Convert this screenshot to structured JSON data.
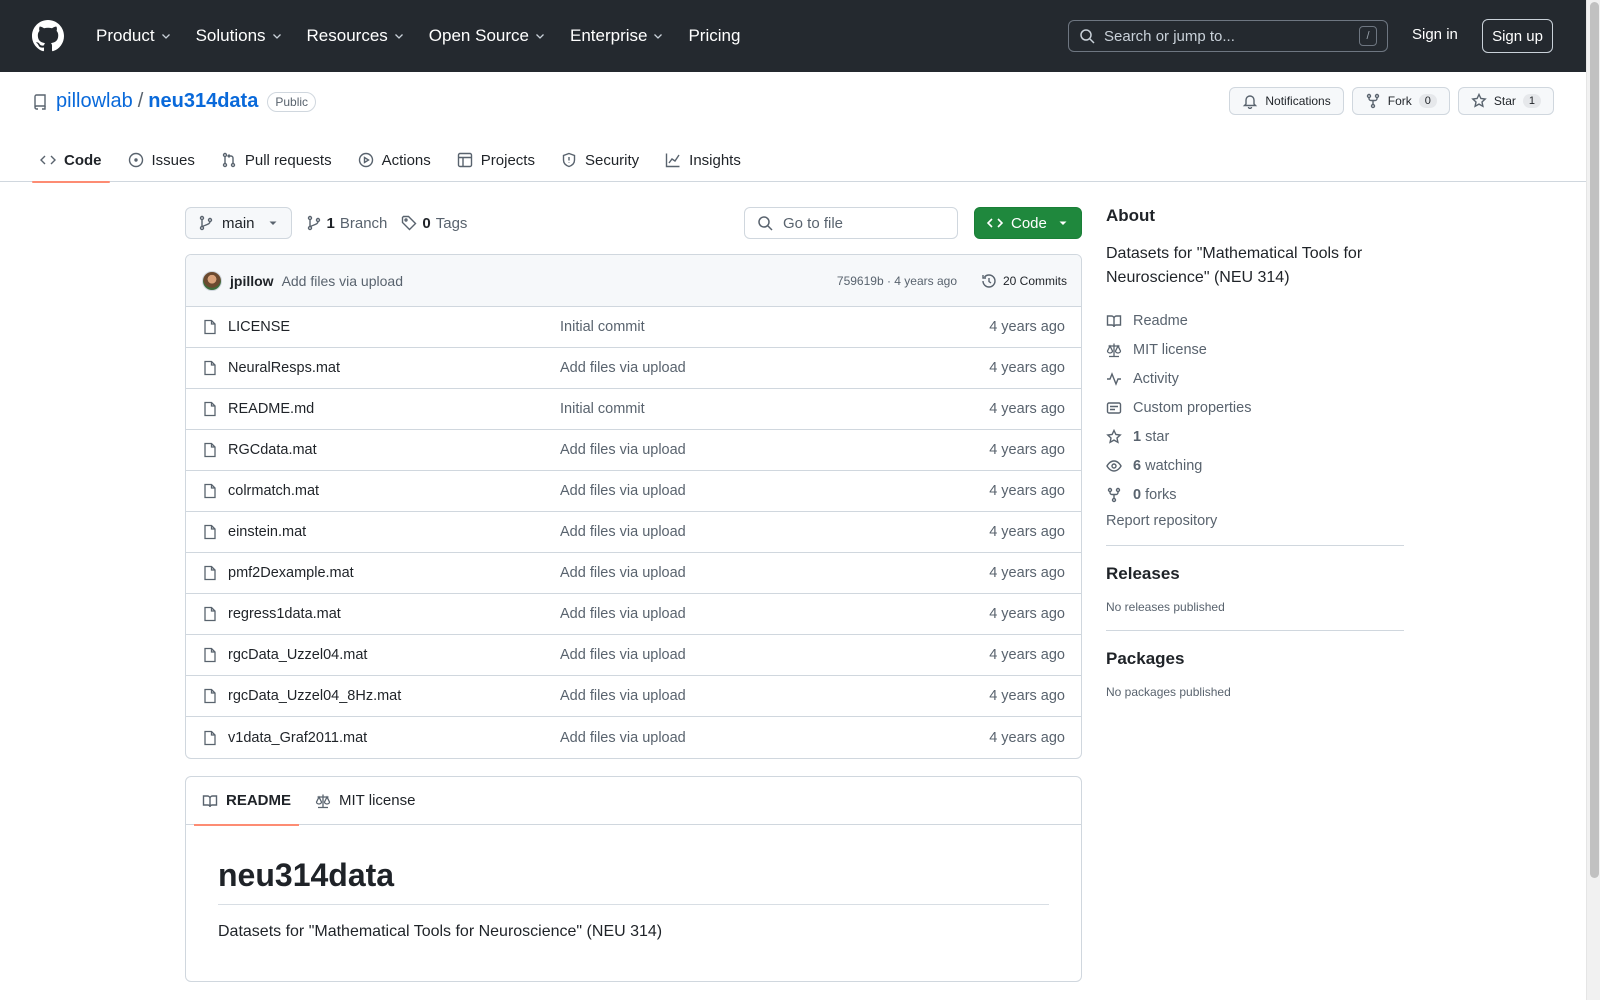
{
  "header": {
    "nav": [
      "Product",
      "Solutions",
      "Resources",
      "Open Source",
      "Enterprise",
      "Pricing"
    ],
    "nav_dropdown": [
      true,
      true,
      true,
      true,
      true,
      false
    ],
    "search_placeholder": "Search or jump to...",
    "search_shortcut": "/",
    "signin": "Sign in",
    "signup": "Sign up"
  },
  "repo": {
    "owner": "pillowlab",
    "separator": "/",
    "name": "neu314data",
    "visibility": "Public",
    "notifications": "Notifications",
    "fork_label": "Fork",
    "fork_count": "0",
    "star_label": "Star",
    "star_count": "1",
    "tabs": [
      {
        "label": "Code",
        "icon": "code-icon",
        "active": true
      },
      {
        "label": "Issues",
        "icon": "issue-icon",
        "active": false
      },
      {
        "label": "Pull requests",
        "icon": "pull-request-icon",
        "active": false
      },
      {
        "label": "Actions",
        "icon": "play-icon",
        "active": false
      },
      {
        "label": "Projects",
        "icon": "table-icon",
        "active": false
      },
      {
        "label": "Security",
        "icon": "shield-icon",
        "active": false
      },
      {
        "label": "Insights",
        "icon": "graph-icon",
        "active": false
      }
    ]
  },
  "toolbar": {
    "branch": "main",
    "branch_count": "1",
    "branch_label": "Branch",
    "tag_count": "0",
    "tag_label": "Tags",
    "goto_placeholder": "Go to file",
    "code_button": "Code"
  },
  "commit": {
    "author": "jpillow",
    "message": "Add files via upload",
    "sha_age": "759619b · 4 years ago",
    "commits": "20 Commits"
  },
  "files": [
    {
      "name": "LICENSE",
      "message": "Initial commit",
      "age": "4 years ago"
    },
    {
      "name": "NeuralResps.mat",
      "message": "Add files via upload",
      "age": "4 years ago"
    },
    {
      "name": "README.md",
      "message": "Initial commit",
      "age": "4 years ago"
    },
    {
      "name": "RGCdata.mat",
      "message": "Add files via upload",
      "age": "4 years ago"
    },
    {
      "name": "colrmatch.mat",
      "message": "Add files via upload",
      "age": "4 years ago"
    },
    {
      "name": "einstein.mat",
      "message": "Add files via upload",
      "age": "4 years ago"
    },
    {
      "name": "pmf2Dexample.mat",
      "message": "Add files via upload",
      "age": "4 years ago"
    },
    {
      "name": "regress1data.mat",
      "message": "Add files via upload",
      "age": "4 years ago"
    },
    {
      "name": "rgcData_Uzzel04.mat",
      "message": "Add files via upload",
      "age": "4 years ago"
    },
    {
      "name": "rgcData_Uzzel04_8Hz.mat",
      "message": "Add files via upload",
      "age": "4 years ago"
    },
    {
      "name": "v1data_Graf2011.mat",
      "message": "Add files via upload",
      "age": "4 years ago"
    }
  ],
  "readme": {
    "tab_readme": "README",
    "tab_license": "MIT license",
    "heading": "neu314data",
    "body": "Datasets for \"Mathematical Tools for Neuroscience\" (NEU 314)"
  },
  "sidebar": {
    "about_heading": "About",
    "about_description": "Datasets for \"Mathematical Tools for Neuroscience\" (NEU 314)",
    "readme": "Readme",
    "license": "MIT license",
    "activity": "Activity",
    "custom_properties": "Custom properties",
    "stars_count": "1",
    "stars_label": "star",
    "watching_count": "6",
    "watching_label": "watching",
    "forks_count": "0",
    "forks_label": "forks",
    "report": "Report repository",
    "releases_heading": "Releases",
    "releases_text": "No releases published",
    "packages_heading": "Packages",
    "packages_text": "No packages published"
  }
}
